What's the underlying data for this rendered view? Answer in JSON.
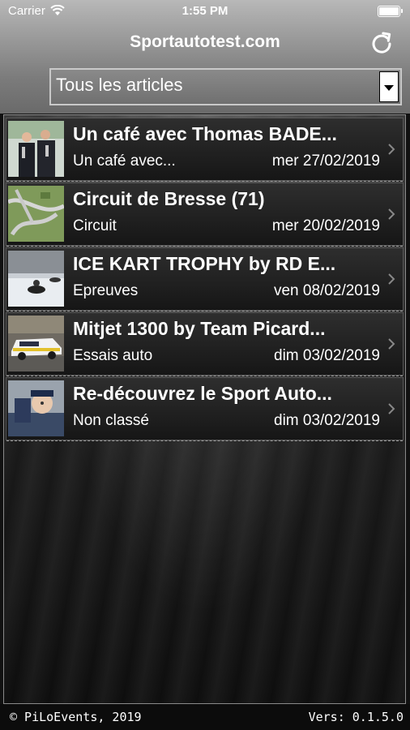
{
  "status_bar": {
    "carrier": "Carrier",
    "time": "1:55 PM"
  },
  "header": {
    "title": "Sportautotest.com"
  },
  "filter": {
    "selected": "Tous les articles"
  },
  "articles": [
    {
      "title": "Un café avec Thomas BADE...",
      "category": "Un café avec...",
      "date": "mer 27/02/2019"
    },
    {
      "title": "Circuit de Bresse (71)",
      "category": "Circuit",
      "date": "mer 20/02/2019"
    },
    {
      "title": "ICE KART TROPHY by RD E...",
      "category": "Epreuves",
      "date": "ven 08/02/2019"
    },
    {
      "title": "Mitjet 1300 by Team Picard...",
      "category": "Essais auto",
      "date": "dim 03/02/2019"
    },
    {
      "title": "Re-découvrez le Sport Auto...",
      "category": "Non classé",
      "date": "dim 03/02/2019"
    }
  ],
  "footer": {
    "copyright": "© PiLoEvents, 2019",
    "version": "Vers: 0.1.5.0"
  }
}
